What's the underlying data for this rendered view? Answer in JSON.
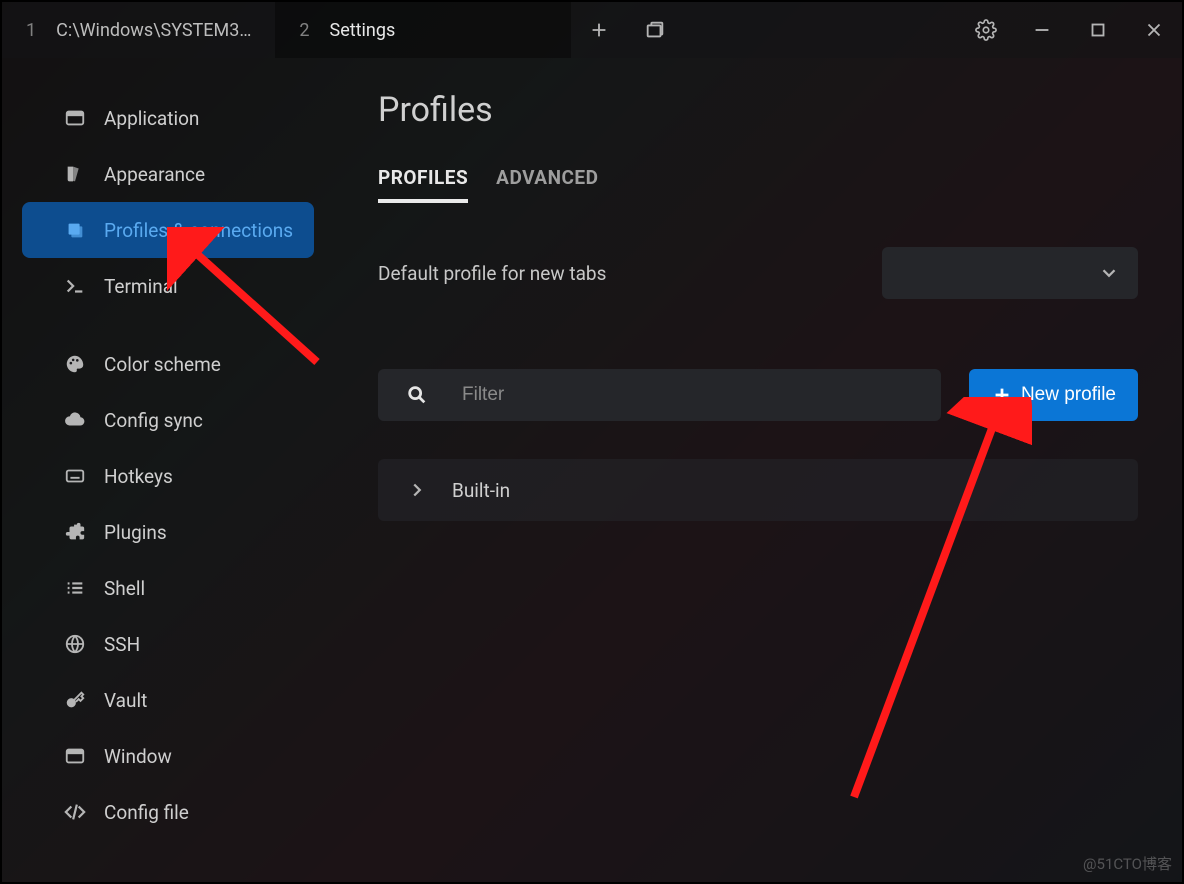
{
  "titlebar": {
    "tabs": [
      {
        "index": "1",
        "label": "C:\\Windows\\SYSTEM3…"
      },
      {
        "index": "2",
        "label": "Settings"
      }
    ]
  },
  "sidebar": {
    "items": [
      {
        "label": "Application"
      },
      {
        "label": "Appearance"
      },
      {
        "label": "Profiles & connections"
      },
      {
        "label": "Terminal"
      },
      {
        "label": "Color scheme"
      },
      {
        "label": "Config sync"
      },
      {
        "label": "Hotkeys"
      },
      {
        "label": "Plugins"
      },
      {
        "label": "Shell"
      },
      {
        "label": "SSH"
      },
      {
        "label": "Vault"
      },
      {
        "label": "Window"
      },
      {
        "label": "Config file"
      }
    ]
  },
  "main": {
    "title": "Profiles",
    "subtabs": {
      "profiles": "PROFILES",
      "advanced": "ADVANCED"
    },
    "default_profile_label": "Default profile for new tabs",
    "filter_placeholder": "Filter",
    "new_profile_label": "New profile",
    "group_builtin": "Built-in"
  },
  "watermark": "@51CTO博客"
}
